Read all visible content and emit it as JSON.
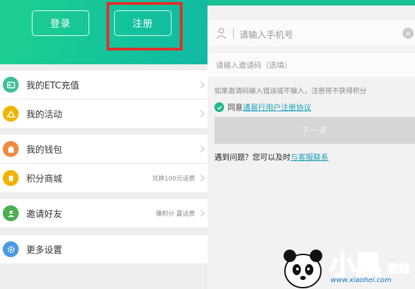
{
  "left": {
    "login_label": "登录",
    "register_label": "注册",
    "menu": [
      {
        "label": "我的ETC充值",
        "hint": "",
        "icon": "etc-card-icon",
        "color": "#3fbf9a"
      },
      {
        "label": "我的活动",
        "hint": "",
        "icon": "activity-icon",
        "color": "#f0b400"
      },
      {
        "label": "我的钱包",
        "hint": "",
        "icon": "wallet-icon",
        "color": "#f08a3c"
      },
      {
        "label": "积分商城",
        "hint": "兑换100元话费",
        "icon": "points-mall-icon",
        "color": "#f0b400"
      },
      {
        "label": "邀请好友",
        "hint": "赚积分 赢话费",
        "icon": "invite-friends-icon",
        "color": "#4caf50"
      },
      {
        "label": "更多设置",
        "hint": "",
        "icon": "settings-icon",
        "color": "#4a9be0"
      }
    ]
  },
  "right": {
    "phone_placeholder": "请输入手机号",
    "invite_placeholder": "请输入邀请码（选填）",
    "invite_note": "如果邀请码输入错误或不输入，注册将不获得积分",
    "agree_prefix": "同意",
    "agree_link": "通易行用户注册协议",
    "next_label": "下一步",
    "help_prefix": "遇到问题？您可以及时",
    "help_link": "与客服联系"
  },
  "watermark": {
    "brand": "小黑",
    "game": "游戏",
    "url": "www.xiaohei.com"
  },
  "colors": {
    "accent": "#17bf95",
    "highlight": "#e0302a",
    "link": "#1a9fb8"
  }
}
